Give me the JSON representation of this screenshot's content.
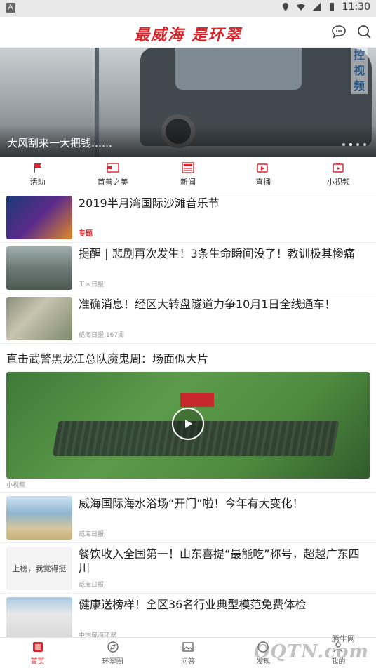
{
  "status_bar": {
    "time": "11:30",
    "left_icon": "A"
  },
  "header": {
    "title": "最威海 是环翠",
    "icons": [
      "message-icon",
      "search-icon"
    ]
  },
  "banner": {
    "caption": "大风刮来一大把钱……",
    "side_tag": "控视频",
    "slides": 4,
    "active_slide": 2
  },
  "tabs": [
    {
      "label": "活动",
      "icon": "flag-icon"
    },
    {
      "label": "首善之美",
      "icon": "slide-icon"
    },
    {
      "label": "新闻",
      "icon": "news-icon"
    },
    {
      "label": "直播",
      "icon": "live-icon"
    },
    {
      "label": "小视频",
      "icon": "tv-icon"
    }
  ],
  "feed": {
    "items": [
      {
        "title": "2019半月湾国际沙滩音乐节",
        "meta": "专题"
      },
      {
        "title": "提醒 | 悲剧再次发生！3条生命瞬间没了！教训极其惨痛",
        "meta": "工人日报"
      },
      {
        "title": "准确消息！经区大转盘隧道力争10月1日全线通车！",
        "meta": "威海日报   167阅"
      }
    ],
    "video": {
      "title": "直击武警黑龙江总队魔鬼周：场面似大片",
      "meta": "小视频"
    },
    "items2": [
      {
        "title": "威海国际海水浴场“开门”啦！今年有大变化！",
        "meta": "威海日报"
      },
      {
        "title": "餐饮收入全国第一！山东喜提“最能吃”称号，超越广东四川",
        "meta": "威海日报",
        "thumb_text": "上榜，我觉得挺"
      },
      {
        "title": "健康送榜样！全区36名行业典型模范免费体检",
        "meta": "中国威海环翠"
      }
    ]
  },
  "bottom_nav": [
    {
      "label": "首页",
      "active": true
    },
    {
      "label": "环翠圈",
      "active": false
    },
    {
      "label": "问答",
      "active": false
    },
    {
      "label": "发现",
      "active": false
    },
    {
      "label": "我的",
      "active": false
    }
  ],
  "watermark": {
    "top": "腾牛网",
    "main": "QQTN.com"
  },
  "colors": {
    "brand": "#d6252b",
    "muted": "#999999"
  }
}
